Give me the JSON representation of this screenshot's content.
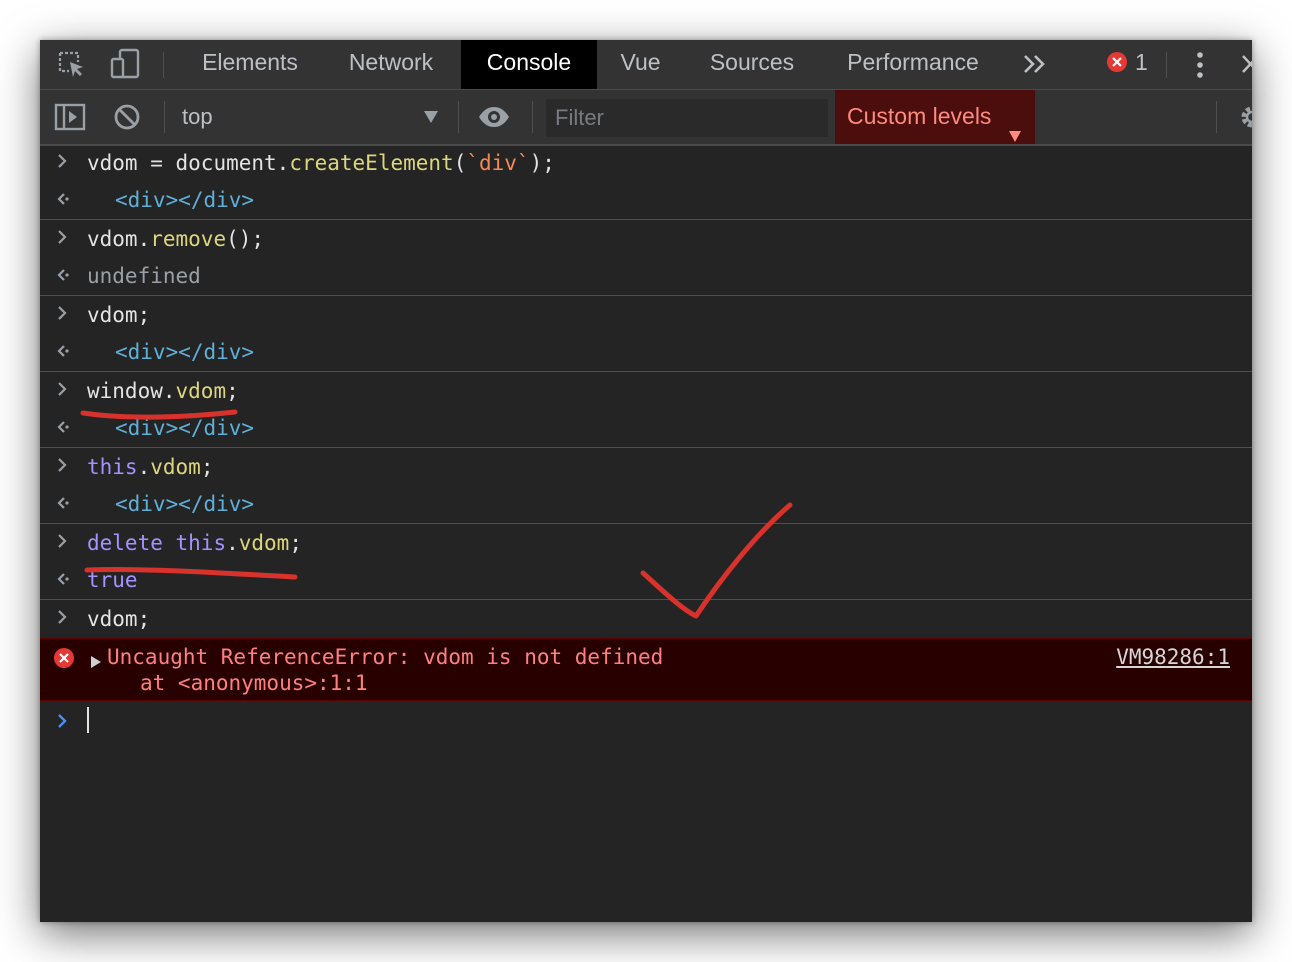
{
  "tabs": [
    {
      "label": "Elements"
    },
    {
      "label": "Network"
    },
    {
      "label": "Console"
    },
    {
      "label": "Vue"
    },
    {
      "label": "Sources"
    },
    {
      "label": "Performance"
    }
  ],
  "active_tab": "Console",
  "error_count": "1",
  "toolbar": {
    "context": "top",
    "filter_placeholder": "Filter",
    "levels": "Custom levels"
  },
  "console": {
    "entries": [
      {
        "input": [
          "vdom",
          " = ",
          "document",
          ".",
          "createElement",
          "(",
          "`div`",
          ");"
        ],
        "output": "<div></div>"
      },
      {
        "input": [
          "vdom",
          ".",
          "remove",
          "();"
        ],
        "output": "undefined"
      },
      {
        "input": [
          "vdom",
          ";"
        ],
        "output": "<div></div>"
      },
      {
        "input": [
          "window",
          ".",
          "vdom",
          ";"
        ],
        "output": "<div></div>"
      },
      {
        "input": [
          "this",
          ".",
          "vdom",
          ";"
        ],
        "output": "<div></div>"
      },
      {
        "input": [
          "delete",
          " ",
          "this",
          ".",
          "vdom",
          ";"
        ],
        "output": "true"
      },
      {
        "input": [
          "vdom",
          ";"
        ]
      }
    ],
    "error": {
      "message": "Uncaught ReferenceError: vdom is not defined",
      "stack": "at <anonymous>:1:1",
      "source": "VM98286:1"
    }
  },
  "colors": {
    "background": "#242424",
    "toolbar": "#333333",
    "error_background": "#290000",
    "error_text": "#ff8080",
    "function": "#dcd67d",
    "string": "#f28b54",
    "tag": "#5db0d7",
    "keyword": "#a492ff",
    "annotation": "#d7322b"
  },
  "icons": [
    "inspect-element-icon",
    "device-toolbar-icon",
    "more-tabs-icon",
    "error-badge-icon",
    "kebab-menu-icon",
    "close-devtools-icon",
    "sidebar-toggle-icon",
    "clear-console-icon",
    "dropdown-arrow-icon",
    "live-expression-eye-icon",
    "settings-gear-icon",
    "expand-triangle-icon",
    "input-prompt-icon",
    "output-return-icon",
    "error-circle-icon"
  ]
}
